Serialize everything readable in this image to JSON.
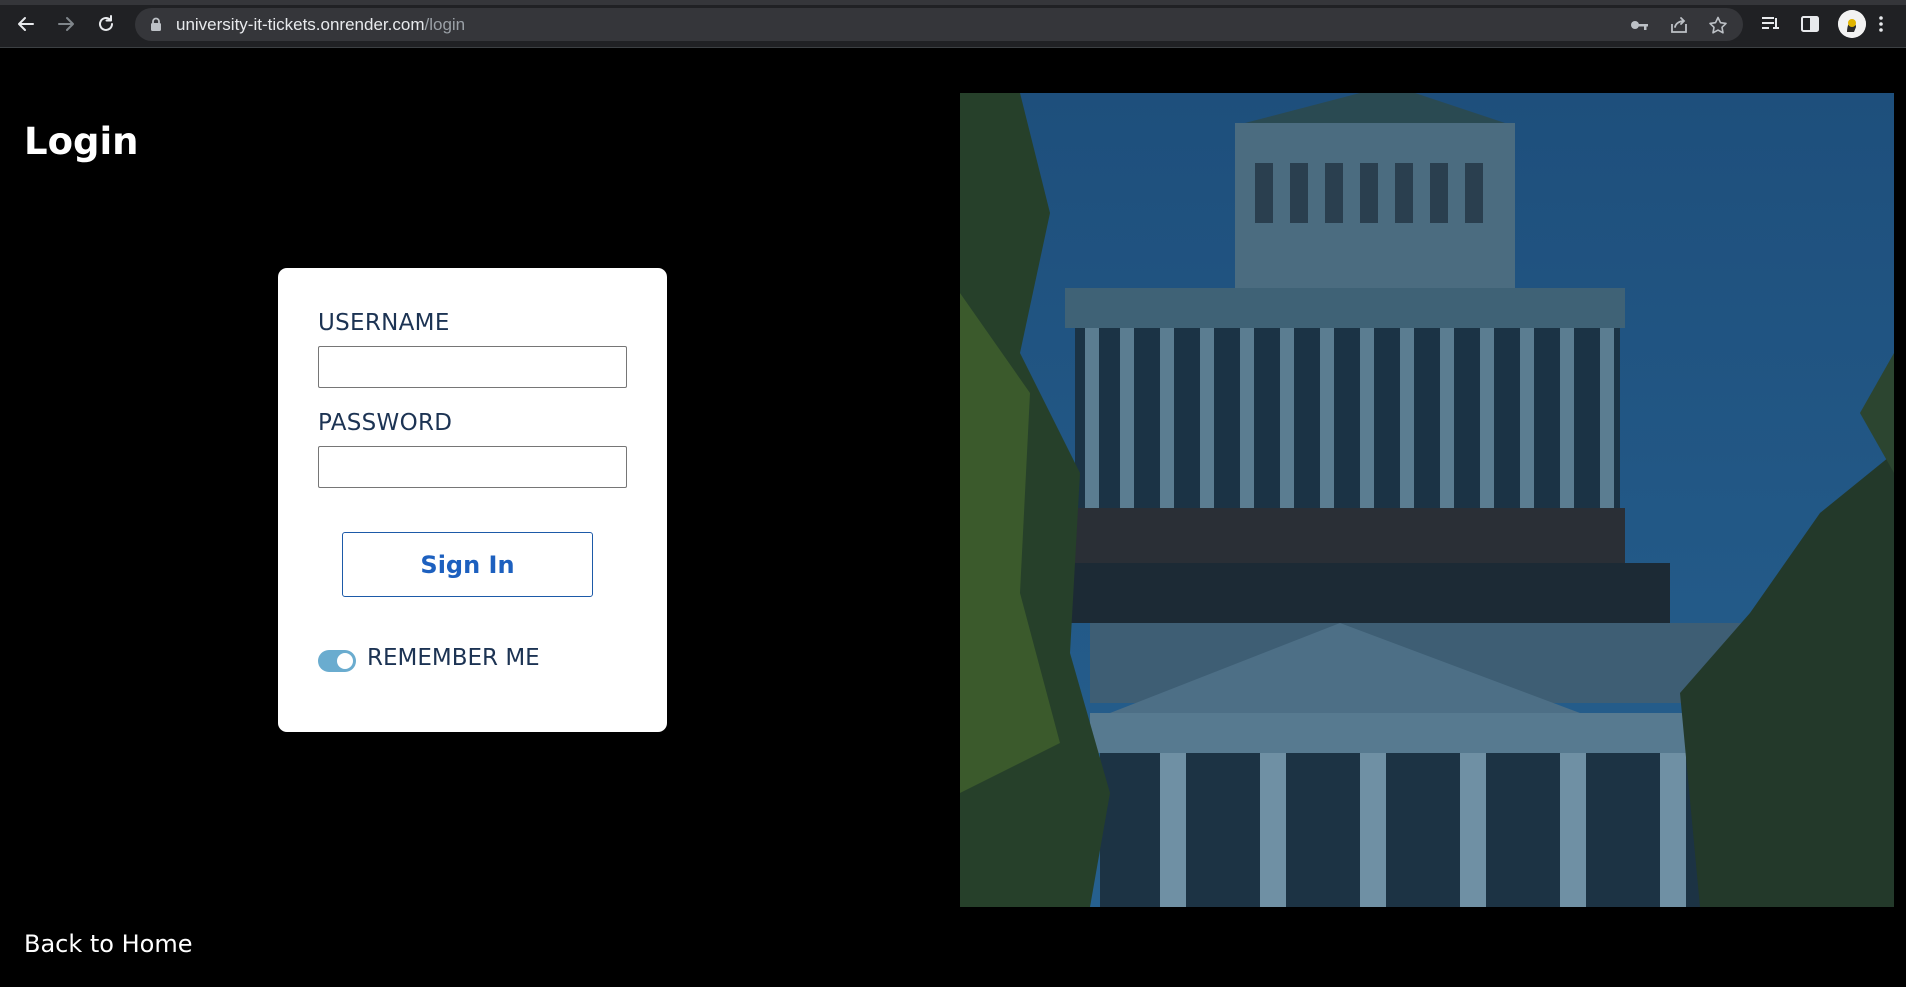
{
  "browser": {
    "url_host": "university-it-tickets.onrender.com",
    "url_path": "/login",
    "icons": [
      "back-icon",
      "forward-icon",
      "reload-icon",
      "lock-icon",
      "key-icon",
      "share-icon",
      "star-icon",
      "reading-list-icon",
      "side-panel-icon",
      "profile-avatar",
      "menu-icon"
    ]
  },
  "page": {
    "title": "Login",
    "back_link": "Back to Home",
    "hero_image": "university-building-dome-photo"
  },
  "form": {
    "username_label": "USERNAME",
    "username_value": "",
    "password_label": "PASSWORD",
    "password_value": "",
    "submit_label": "Sign In",
    "remember_label": "REMEMBER ME",
    "remember_checked": true
  },
  "colors": {
    "background": "#000000",
    "card": "#ffffff",
    "label_text": "#1c3353",
    "button_text": "#1d60bf",
    "toggle_on": "#6aaccf",
    "hero_tint": "#1f4d77"
  }
}
